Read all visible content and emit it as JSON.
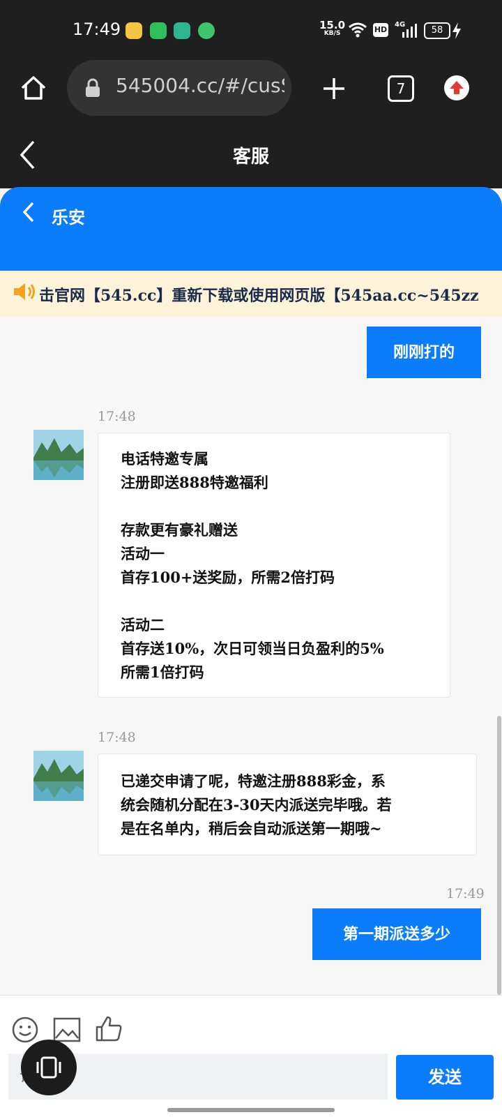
{
  "status_bar": {
    "time": "17:49",
    "net_speed_value": "15.0",
    "net_speed_unit": "KB/S",
    "hd_label": "HD",
    "signal_label": "4G",
    "battery": "58"
  },
  "browser": {
    "url": "545004.cc/#/cusS",
    "tab_count": "7"
  },
  "page": {
    "title": "客服"
  },
  "chat_header": {
    "title": "乐安"
  },
  "notice": {
    "text": "击官网【545.cc】重新下载或使用网页版【545aa.cc~545zz"
  },
  "messages": [
    {
      "side": "right",
      "timestamp": "",
      "lines": [
        "刚刚打的"
      ]
    },
    {
      "side": "left",
      "timestamp": "17:48",
      "lines": [
        "电话特邀专属",
        "注册即送888特邀福利",
        "",
        "存款更有豪礼赠送",
        "活动一",
        "首存100+送奖励，所需2倍打码",
        "",
        "活动二",
        "首存送10%，次日可领当日负盈利的5%",
        "所需1倍打码"
      ]
    },
    {
      "side": "left",
      "timestamp": "17:48",
      "lines": [
        "已递交申请了呢，特邀注册888彩金，系",
        "统会随机分配在3-30天内派送完毕哦。若",
        "是在名单内，稍后会自动派送第一期哦~"
      ]
    },
    {
      "side": "right",
      "timestamp": "17:49",
      "lines": [
        "第一期派送多少"
      ]
    }
  ],
  "input": {
    "placeholder": "请输入"
  },
  "send_label": "发送",
  "colors": {
    "accent": "#0a7cfc",
    "dark_bar": "#1f1f1f",
    "notice_bg": "#fdf3d8"
  },
  "icons": [
    "home-icon",
    "lock-icon",
    "plus-icon",
    "tabs-icon",
    "update-icon",
    "back-icon",
    "speaker-icon",
    "emoji-icon",
    "image-icon",
    "thumbs-up-icon",
    "vibrate-icon"
  ]
}
